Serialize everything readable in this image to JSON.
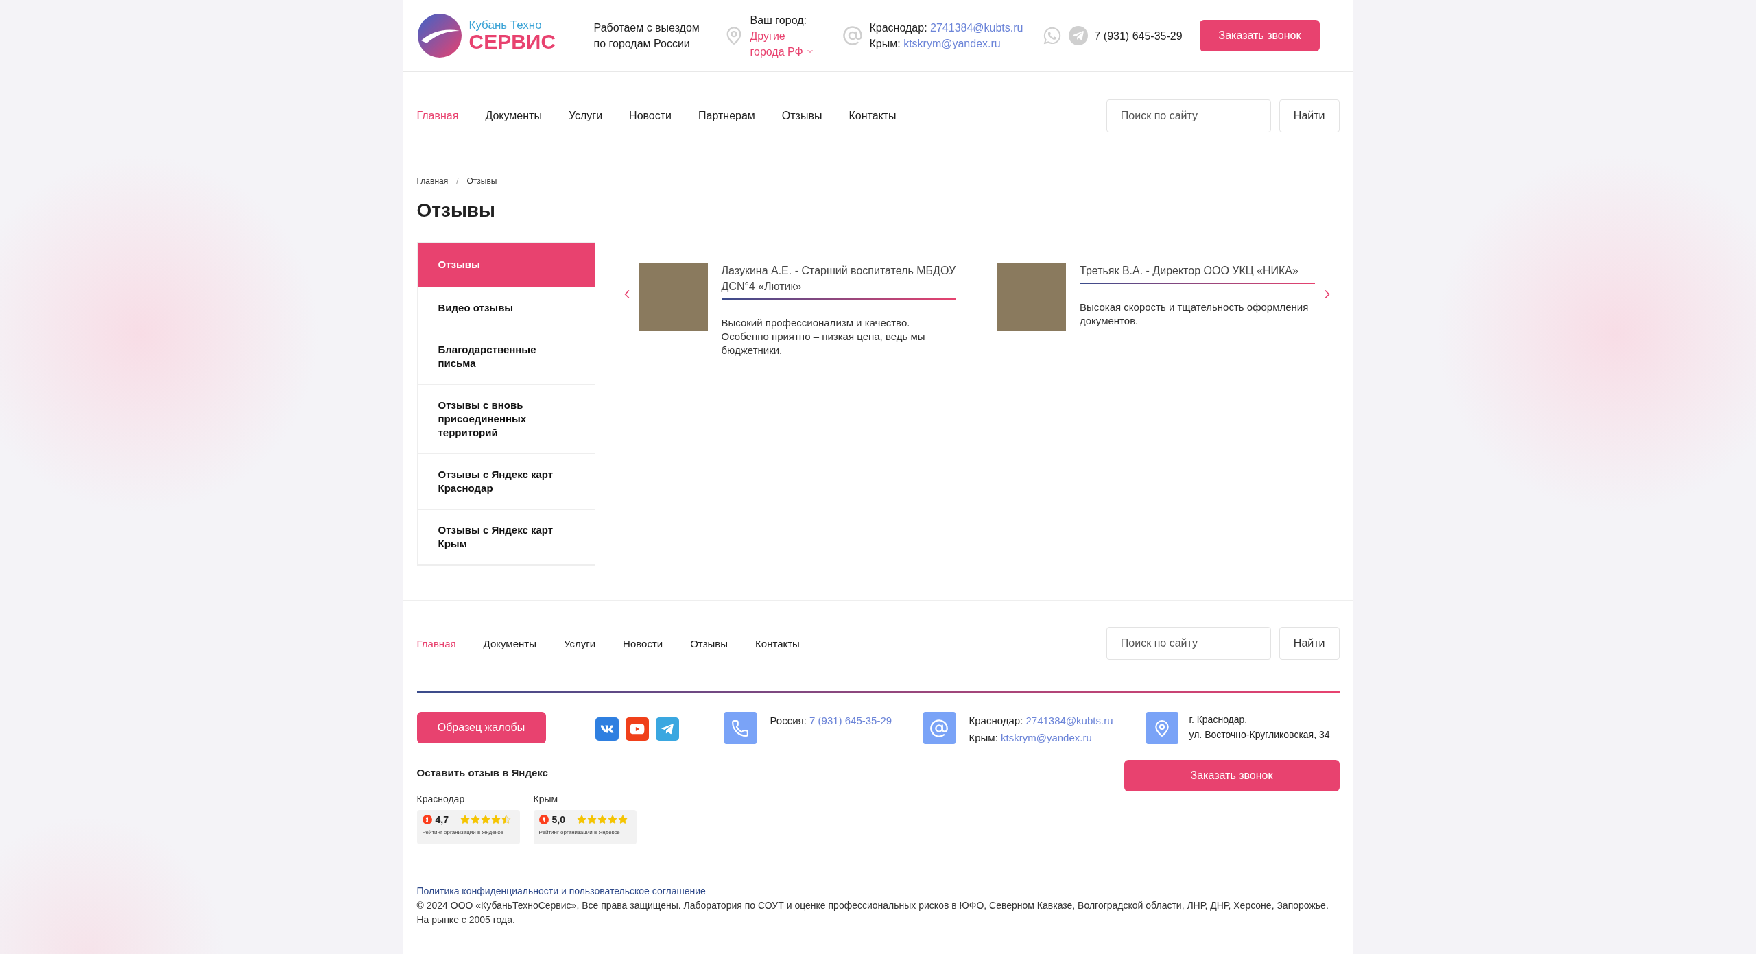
{
  "header": {
    "logo": {
      "line1": "Кубань Техно",
      "line2": "СЕРВИС"
    },
    "tagline": "Работаем с выездом по городам России",
    "city": {
      "label": "Ваш город:",
      "value": "Другие города РФ"
    },
    "emails": [
      {
        "city": "Краснодар:",
        "email": "2741384@kubts.ru"
      },
      {
        "city": "Крым:",
        "email": "ktskrym@yandex.ru"
      }
    ],
    "phone": "7 (931) 645-35-29",
    "callback_button": "Заказать звонок"
  },
  "nav": {
    "items": [
      {
        "label": "Главная",
        "selected": true
      },
      {
        "label": "Документы",
        "selected": false
      },
      {
        "label": "Услуги",
        "selected": false
      },
      {
        "label": "Новости",
        "selected": false
      },
      {
        "label": "Партнерам",
        "selected": false
      },
      {
        "label": "Отзывы",
        "selected": false
      },
      {
        "label": "Контакты",
        "selected": false
      }
    ],
    "search": {
      "placeholder": "Поиск по сайту",
      "button": "Найти"
    }
  },
  "breadcrumbs": [
    "Главная",
    "Отзывы"
  ],
  "breadcrumb_separator": "/",
  "title": "Отзывы",
  "sidebar": {
    "items": [
      {
        "label": "Отзывы",
        "selected": true
      },
      {
        "label": "Видео отзывы",
        "selected": false
      },
      {
        "label": "Благодарственные письма",
        "selected": false
      },
      {
        "label": "Отзывы с вновь присоединенных территорий",
        "selected": false
      },
      {
        "label": "Отзывы с Яндекс карт Краснодар",
        "selected": false
      },
      {
        "label": "Отзывы с Яндекс карт Крым",
        "selected": false
      }
    ]
  },
  "reviews": [
    {
      "title": "Лазукина А.Е. - Старший воспитатель МБДОУ ДСN°4 «Лютик»",
      "text": "Высокий профессионализм и качество. Особенно приятно – низкая цена, ведь мы бюджетники."
    },
    {
      "title": "Третьяк В.А. - Директор ООО УКЦ «НИКА»",
      "text": "Высокая скорость и тщательность оформления документов."
    }
  ],
  "footer": {
    "nav": {
      "items": [
        {
          "label": "Главная",
          "selected": true
        },
        {
          "label": "Документы",
          "selected": false
        },
        {
          "label": "Услуги",
          "selected": false
        },
        {
          "label": "Новости",
          "selected": false
        },
        {
          "label": "Отзывы",
          "selected": false
        },
        {
          "label": "Контакты",
          "selected": false
        }
      ],
      "search": {
        "placeholder": "Поиск по сайту",
        "button": "Найти"
      }
    },
    "complaint_button": "Образец жалобы",
    "phone": {
      "label": "Россия:",
      "value": "7 (931) 645-35-29"
    },
    "emails": [
      {
        "city": "Краснодар:",
        "email": "2741384@kubts.ru"
      },
      {
        "city": "Крым:",
        "email": "ktskrym@yandex.ru"
      }
    ],
    "address": [
      "г. Краснодар,",
      "ул. Восточно-Кругликовская, 34"
    ],
    "callback_button": "Заказать звонок",
    "yandex": {
      "title": "Оставить отзыв в Яндекс",
      "ratings": [
        {
          "city": "Краснодар",
          "score": "4,7",
          "stars": 4.5,
          "caption": "Рейтинг организации в Яндексе"
        },
        {
          "city": "Крым",
          "score": "5,0",
          "stars": 5,
          "caption": "Рейтинг организации в Яндексе"
        }
      ]
    },
    "policy_link": "Политика конфиденциальности и пользовательское соглашение",
    "copyright": "© 2024 ООО «КубаньТехноСервис», Все права защищены. Лаборатория по СОУТ и оценке профессиональных рисков в ЮФО, Северном Кавказе, Волгоградской области, ЛНР, ДНР, Херсоне, Запорожье. На рынке с 2005 года."
  }
}
